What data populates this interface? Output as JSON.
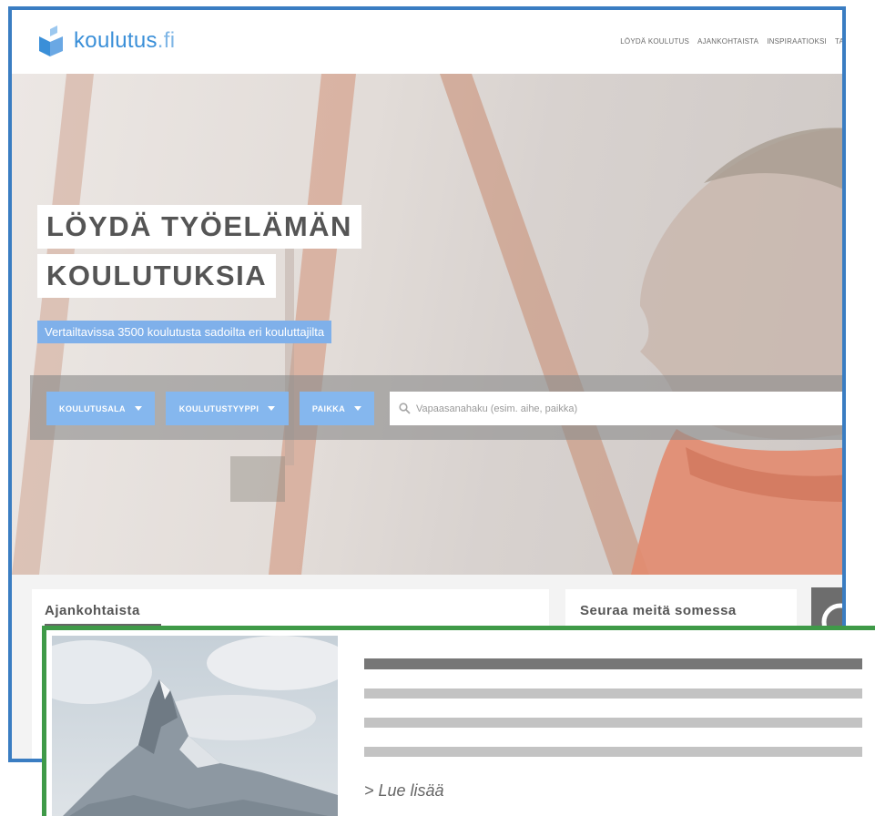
{
  "site": {
    "logo_name": "koulutus",
    "logo_tld": ".fi",
    "nav": [
      "LÖYDÄ KOULUTUS",
      "AJANKOHTAISTA",
      "INSPIRAATIOKSI",
      "TAR"
    ]
  },
  "hero": {
    "title_line1": "LÖYDÄ TYÖELÄMÄN",
    "title_line2": "KOULUTUKSIA",
    "subtitle": "Vertailtavissa 3500 koulutusta sadoilta eri kouluttajilta"
  },
  "filters": {
    "field": "KOULUTUSALA",
    "type": "KOULUTUSTYYPPI",
    "place": "PAIKKA",
    "search_placeholder": "Vapaasanahaku (esim. aihe, paikka)"
  },
  "sections": {
    "news_title": "Ajankohtaista",
    "social_title": "Seuraa meitä somessa"
  },
  "article": {
    "read_more": "> Lue lisää"
  },
  "colors": {
    "frame_blue": "#3a7dc2",
    "frame_green": "#3f9a48",
    "accent": "#85b7ee"
  },
  "icons": [
    "logo-icon",
    "search-icon",
    "chevron-down-icon",
    "mountain-thumbnail"
  ]
}
